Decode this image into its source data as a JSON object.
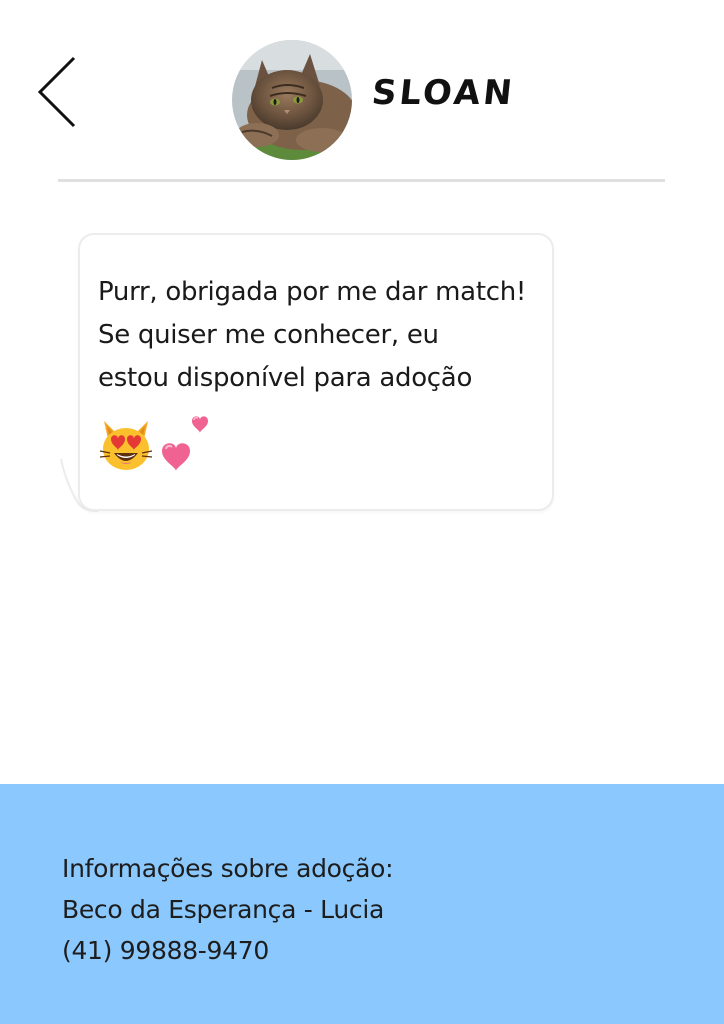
{
  "header": {
    "back_icon": "chevron-left-icon",
    "avatar_alt": "cat-photo",
    "contact_name": "SLOAN"
  },
  "message": {
    "lines": [
      "Purr, obrigada por me dar match!",
      "Se quiser me conhecer, eu",
      "estou disponível para adoção"
    ],
    "emojis": [
      "smiling-cat-heart-eyes-icon",
      "two-hearts-icon"
    ]
  },
  "footer": {
    "lines": [
      "Informações sobre adoção:",
      "Beco da Esperança - Lucia",
      "(41) 99888-9470"
    ]
  },
  "colors": {
    "footer_background": "#8ac8fd",
    "divider": "#e0e0e0",
    "text": "#1a1a1a"
  }
}
